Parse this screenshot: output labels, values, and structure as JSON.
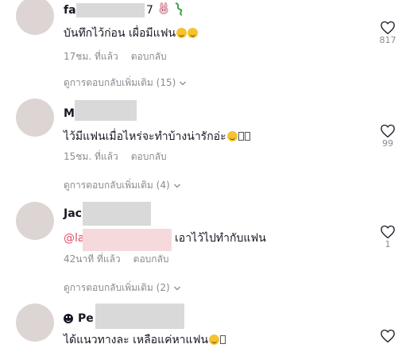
{
  "comments": [
    {
      "username_visible_start": "fa",
      "username_visible_end": "7",
      "text": "บันทึกไว้ก่อน เผื่อมีแฟน",
      "time": "17ชม. ที่แล้ว",
      "reply_label": "ตอบกลับ",
      "like_count": "817",
      "view_more": "ดูการตอบกลับเพิ่มเติม (15)"
    },
    {
      "username_visible_start": "M",
      "text": "ไว้มีแฟนเมื่อไหร่จะทำบ้างน่ารักอ่ะ",
      "time": "15ชม. ที่แล้ว",
      "reply_label": "ตอบกลับ",
      "like_count": "99",
      "view_more": "ดูการตอบกลับเพิ่มเติม (4)"
    },
    {
      "username_visible_start": "Jac",
      "mention_visible_start": "@la",
      "text": "เอาไว้ไปทำกับแฟน",
      "time": "42นาที ที่แล้ว",
      "reply_label": "ตอบกลับ",
      "like_count": "1",
      "view_more": "ดูการตอบกลับเพิ่มเติม (2)"
    },
    {
      "username_visible_start": "Pe",
      "text": "ได้แนวทางละ เหลือแค่หาแฟน"
    }
  ],
  "colors": {
    "text": "#161823",
    "secondary": "#8a8b91",
    "mention": "#e34b62",
    "avatar": "#ddd5d3",
    "redaction": "#d9d9d9"
  }
}
